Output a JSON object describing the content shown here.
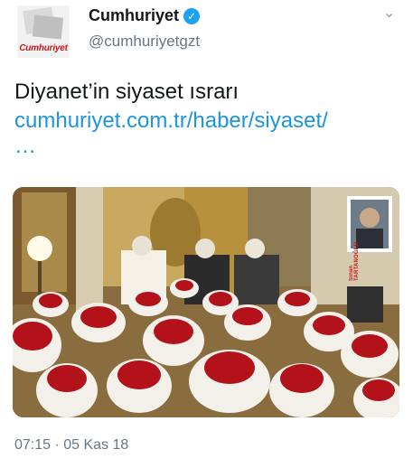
{
  "account": {
    "display_name": "Cumhuriyet",
    "handle": "@cumhuriyetgzt",
    "avatar_logo_text": "Cumhuriyet",
    "verified": true,
    "verified_icon": "verified-badge-icon"
  },
  "menu": {
    "icon": "chevron-down-icon",
    "glyph": "⌄"
  },
  "tweet": {
    "text": "Diyanet’in siyaset ısrarı",
    "link": "cumhuriyet.com.tr/haber/siyaset/",
    "link_ellipsis": "…"
  },
  "photo": {
    "photographer_credit": "Sinan TARTANOĞLU"
  },
  "meta": {
    "timestamp": "07:15 · 05 Kas 18"
  },
  "colors": {
    "link": "#1b95e0",
    "verified": "#1da1f2",
    "secondary_text": "#657786",
    "brand_red": "#c4161c"
  }
}
